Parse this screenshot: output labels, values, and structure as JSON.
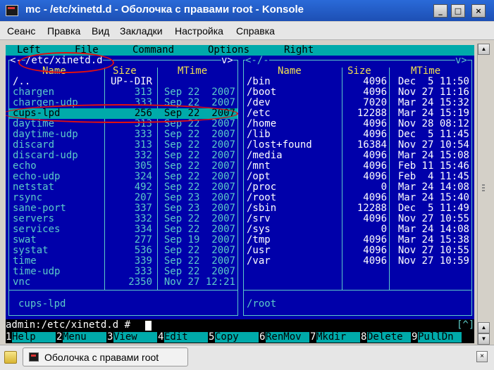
{
  "window": {
    "title": "mc - /etc/xinetd.d - Оболочка с правами root - Konsole",
    "min_glyph": "_",
    "max_glyph": "□",
    "close_glyph": "×"
  },
  "menubar": [
    "Сеанс",
    "Правка",
    "Вид",
    "Закладки",
    "Настройка",
    "Справка"
  ],
  "mc": {
    "top_menu": [
      "Left",
      "File",
      "Command",
      "Options",
      "Right"
    ],
    "left_panel": {
      "path": "/etc/xinetd.d",
      "path_prefix": "<-",
      "path_suffix": "v>",
      "headers": {
        "name": "Name",
        "size": "Size",
        "mtime": "MTime"
      },
      "rows": [
        {
          "name": "/..",
          "size": "UP--DIR",
          "date": ""
        },
        {
          "name": "chargen",
          "size": "313",
          "date": "Sep 22  2007"
        },
        {
          "name": "chargen-udp",
          "size": "333",
          "date": "Sep 22  2007"
        },
        {
          "name": "cups-lpd",
          "size": "256",
          "date": "Sep 22  2007"
        },
        {
          "name": "daytime",
          "size": "313",
          "date": "Sep 22  2007"
        },
        {
          "name": "daytime-udp",
          "size": "333",
          "date": "Sep 22  2007"
        },
        {
          "name": "discard",
          "size": "313",
          "date": "Sep 22  2007"
        },
        {
          "name": "discard-udp",
          "size": "332",
          "date": "Sep 22  2007"
        },
        {
          "name": "echo",
          "size": "305",
          "date": "Sep 22  2007"
        },
        {
          "name": "echo-udp",
          "size": "324",
          "date": "Sep 22  2007"
        },
        {
          "name": "netstat",
          "size": "492",
          "date": "Sep 22  2007"
        },
        {
          "name": "rsync",
          "size": "207",
          "date": "Sep 23  2007"
        },
        {
          "name": "sane-port",
          "size": "337",
          "date": "Sep 23  2007"
        },
        {
          "name": "servers",
          "size": "332",
          "date": "Sep 22  2007"
        },
        {
          "name": "services",
          "size": "334",
          "date": "Sep 22  2007"
        },
        {
          "name": "swat",
          "size": "277",
          "date": "Sep 19  2007"
        },
        {
          "name": "systat",
          "size": "536",
          "date": "Sep 22  2007"
        },
        {
          "name": "time",
          "size": "339",
          "date": "Sep 22  2007"
        },
        {
          "name": "time-udp",
          "size": "333",
          "date": "Sep 22  2007"
        },
        {
          "name": "vnc",
          "size": "2350",
          "date": "Nov 27 12:21"
        }
      ],
      "status": "cups-lpd"
    },
    "right_panel": {
      "path": "<-/-",
      "path_suffix": "v>",
      "headers": {
        "name": "Name",
        "size": "Size",
        "mtime": "MTime"
      },
      "rows": [
        {
          "name": "/bin",
          "size": "4096",
          "date": "Dec  5 11:50"
        },
        {
          "name": "/boot",
          "size": "4096",
          "date": "Nov 27 11:16"
        },
        {
          "name": "/dev",
          "size": "7020",
          "date": "Mar 24 15:32"
        },
        {
          "name": "/etc",
          "size": "12288",
          "date": "Mar 24 15:19"
        },
        {
          "name": "/home",
          "size": "4096",
          "date": "Nov 28 08:12"
        },
        {
          "name": "/lib",
          "size": "4096",
          "date": "Dec  5 11:45"
        },
        {
          "name": "/lost+found",
          "size": "16384",
          "date": "Nov 27 10:54"
        },
        {
          "name": "/media",
          "size": "4096",
          "date": "Mar 24 15:08"
        },
        {
          "name": "/mnt",
          "size": "4096",
          "date": "Feb 11 15:46"
        },
        {
          "name": "/opt",
          "size": "4096",
          "date": "Feb  4 11:45"
        },
        {
          "name": "/proc",
          "size": "0",
          "date": "Mar 24 14:08"
        },
        {
          "name": "/root",
          "size": "4096",
          "date": "Mar 24 15:40"
        },
        {
          "name": "/sbin",
          "size": "12288",
          "date": "Dec  5 11:49"
        },
        {
          "name": "/srv",
          "size": "4096",
          "date": "Nov 27 10:55"
        },
        {
          "name": "/sys",
          "size": "0",
          "date": "Mar 24 14:08"
        },
        {
          "name": "/tmp",
          "size": "4096",
          "date": "Mar 24 15:38"
        },
        {
          "name": "/usr",
          "size": "4096",
          "date": "Nov 27 10:55"
        },
        {
          "name": "/var",
          "size": "4096",
          "date": "Nov 27 10:59"
        }
      ],
      "status": "/root"
    },
    "prompt": "admin:/etc/xinetd.d #",
    "history_hint": "[^]",
    "fkeys": [
      {
        "num": "1",
        "label": "Help"
      },
      {
        "num": "2",
        "label": "Menu"
      },
      {
        "num": "3",
        "label": "View"
      },
      {
        "num": "4",
        "label": "Edit"
      },
      {
        "num": "5",
        "label": "Copy"
      },
      {
        "num": "6",
        "label": "RenMov"
      },
      {
        "num": "7",
        "label": "Mkdir"
      },
      {
        "num": "8",
        "label": "Delete"
      },
      {
        "num": "9",
        "label": "PullDn"
      }
    ]
  },
  "taskbar": {
    "tab_label": "Оболочка с правами root",
    "close_glyph": "×"
  },
  "colors": {
    "terminal_bg": "#0000aa",
    "terminal_fg": "#5ccac8",
    "selection": "#00aaaa",
    "annotation": "#e01010"
  }
}
